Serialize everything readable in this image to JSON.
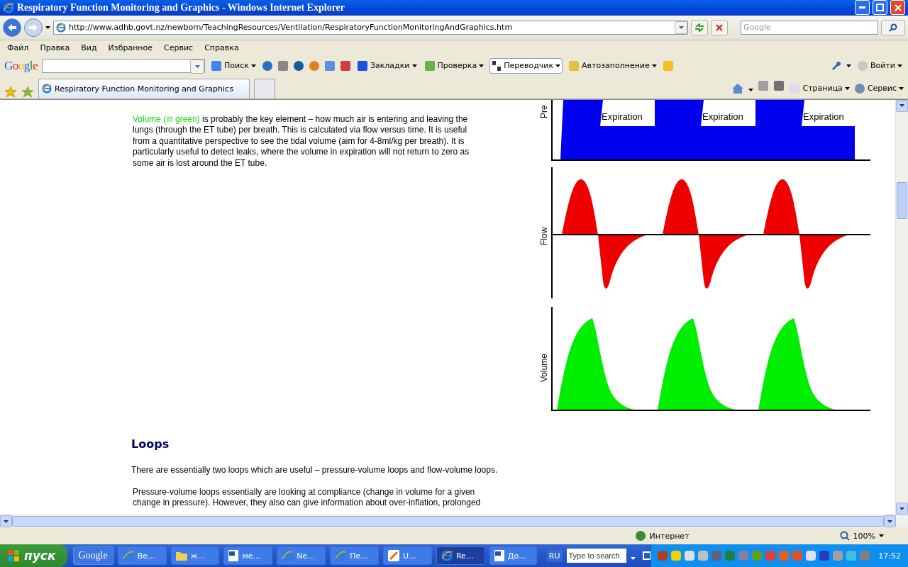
{
  "window": {
    "title": "Respiratory Function Monitoring and Graphics - Windows Internet Explorer"
  },
  "address_bar": {
    "url": "http://www.adhb.govt.nz/newborn/TeachingResources/Ventilation/RespiratoryFunctionMonitoringAndGraphics.htm"
  },
  "search": {
    "placeholder": "Google"
  },
  "menu": [
    "Файл",
    "Правка",
    "Вид",
    "Избранное",
    "Сервис",
    "Справка"
  ],
  "google_toolbar": {
    "logo": "Google",
    "items": [
      {
        "kind": "button",
        "label": "Поиск"
      },
      {
        "kind": "button",
        "label": "Закладки"
      },
      {
        "kind": "button",
        "label": "Проверка"
      },
      {
        "kind": "boxed",
        "label": "Переводчик"
      },
      {
        "kind": "button",
        "label": "Автозаполнение"
      },
      {
        "kind": "signin",
        "label": "Войти"
      }
    ]
  },
  "tabs": [
    {
      "label": "Respiratory Function Monitoring and Graphics",
      "selected": true
    }
  ],
  "command_bar": [
    "Страница",
    "Сервис"
  ],
  "content": {
    "intro": {
      "highlight": "Volume (in green)",
      "lines": [
        " is probably the key element – how much air is entering and leaving the",
        "lungs (through the ET tube) per breath. This is calculated via flow versus time. It is useful",
        "from a quantitative perspective to see the tidal volume (aim for 4-8ml/kg per breath). It is",
        "particularly useful to detect leaks, where the volume in expiration will not return to zero as",
        "some air is lost around the ET tube."
      ]
    },
    "graphs": {
      "pressure_label": "Pre",
      "expiration_labels": [
        "Expiration",
        "Expiration",
        "Expiration"
      ],
      "flow_label": "Flow",
      "volume_label": "Volume"
    },
    "heading": "Loops",
    "summary": "There are essentially two loops which are useful – pressure-volume loops and flow-volume loops.",
    "detail": {
      "lines": [
        "Pressure-volume loops essentially are looking at compliance (change in volume for a given",
        "change in pressure). However, they also can give information about over-inflation, prolonged"
      ]
    }
  },
  "status_bar": {
    "zone": "Интернет",
    "zoom": "100%"
  },
  "taskbar": {
    "start": "пуск",
    "quick_launch": "Google",
    "tasks": [
      {
        "kind": "ie",
        "label": "Ве...",
        "selected": false
      },
      {
        "kind": "folder",
        "label": "ж...",
        "selected": false
      },
      {
        "kind": "word",
        "label": "ме...",
        "selected": false
      },
      {
        "kind": "ie",
        "label": "Ne...",
        "selected": false
      },
      {
        "kind": "ie",
        "label": "Пе...",
        "selected": false
      },
      {
        "kind": "app",
        "label": "U...",
        "selected": false
      },
      {
        "kind": "ie",
        "label": "Re...",
        "selected": true
      },
      {
        "kind": "word",
        "label": "До...",
        "selected": false
      }
    ],
    "language": "RU",
    "search_placeholder": "Type to search",
    "clock": "17:52"
  }
}
